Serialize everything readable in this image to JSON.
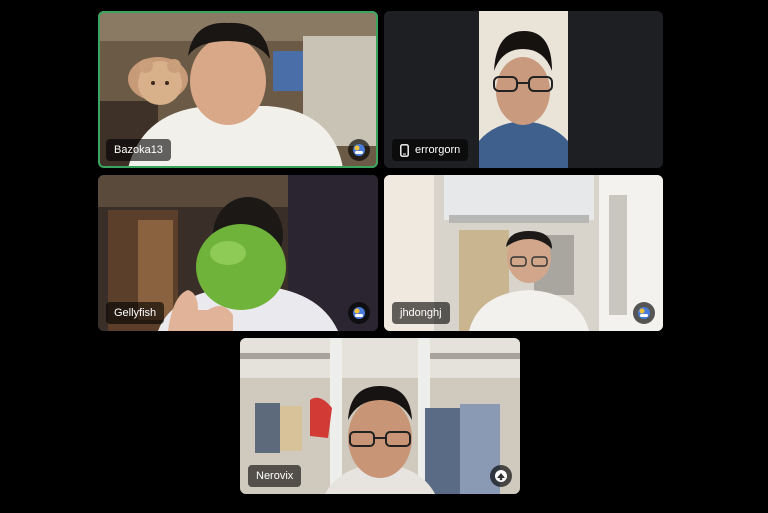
{
  "participants": [
    {
      "name": "Bazoka13",
      "speaking": true,
      "badge_icon": "avatar-icon"
    },
    {
      "name": "errorgorn",
      "device_icon": "mobile-phone-icon"
    },
    {
      "name": "Gellyfish",
      "badge_icon": "avatar-icon"
    },
    {
      "name": "jhdonghj",
      "badge_icon": "avatar-icon"
    },
    {
      "name": "Nerovix",
      "badge_icon": "avatar-icon"
    }
  ],
  "colors": {
    "speaking_border": "#3ba55d",
    "tile_background": "#1e1f22",
    "page_background": "#000000"
  }
}
